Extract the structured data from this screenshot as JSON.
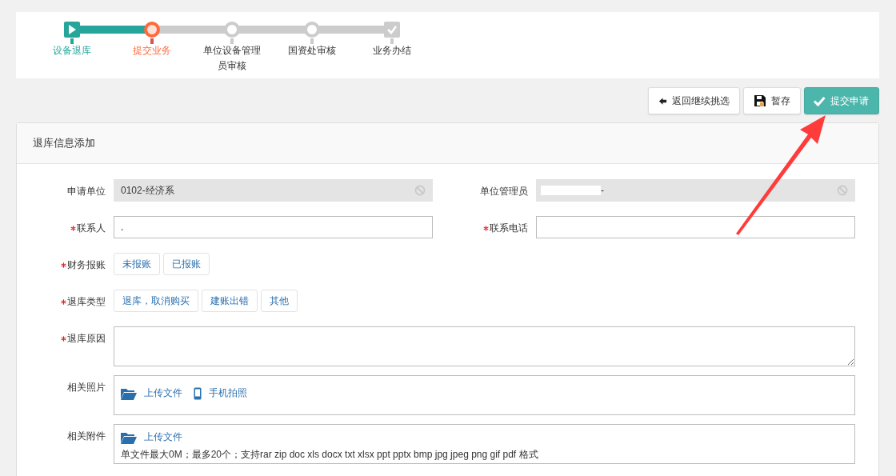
{
  "steps": [
    {
      "kind": "start",
      "label": "设备退库",
      "done": true,
      "current": false
    },
    {
      "kind": "node",
      "label": "提交业务",
      "done": false,
      "current": true
    },
    {
      "kind": "node",
      "label": "单位设备管理员审核",
      "done": false,
      "current": false
    },
    {
      "kind": "node",
      "label": "国资处审核",
      "done": false,
      "current": false
    },
    {
      "kind": "end",
      "label": "业务办结",
      "done": false,
      "current": false
    }
  ],
  "actions": [
    {
      "kind": "back",
      "label": "返回继续挑选"
    },
    {
      "kind": "save",
      "label": "暂存"
    },
    {
      "kind": "submit",
      "label": "提交申请"
    }
  ],
  "panel": {
    "title": "退库信息添加",
    "rows": [
      [
        {
          "kind": "readonly",
          "label": "申请单位",
          "required": false,
          "value": "0102-经济系"
        },
        {
          "kind": "readonly",
          "label": "单位管理员",
          "required": false,
          "value": "-",
          "redacted": true
        }
      ],
      [
        {
          "kind": "text",
          "label": "联系人",
          "required": true,
          "value": "."
        },
        {
          "kind": "text",
          "label": "联系电话",
          "required": true
        }
      ],
      [
        {
          "kind": "options",
          "label": "财务报账",
          "required": true,
          "options": [
            {
              "label": "未报账",
              "selected": false
            },
            {
              "label": "已报账",
              "selected": false
            }
          ]
        }
      ],
      [
        {
          "kind": "options",
          "label": "退库类型",
          "required": true,
          "options": [
            {
              "label": "退库，取消购买",
              "selected": false
            },
            {
              "label": "建账出错",
              "selected": false
            },
            {
              "label": "其他",
              "selected": false
            }
          ]
        }
      ],
      [
        {
          "kind": "textarea",
          "label": "退库原因",
          "required": true
        }
      ],
      [
        {
          "kind": "upload",
          "label": "相关照片",
          "required": false,
          "links": [
            {
              "kind": "folder",
              "label": "上传文件"
            },
            {
              "kind": "phone",
              "label": "手机拍照"
            }
          ]
        }
      ],
      [
        {
          "kind": "upload",
          "label": "相关附件",
          "required": false,
          "links": [
            {
              "kind": "folder",
              "label": "上传文件"
            }
          ],
          "hint": "单文件最大0M；最多20个；支持rar zip doc xls docx txt xlsx ppt pptx bmp jpg jpeg png gif pdf 格式"
        }
      ]
    ]
  }
}
